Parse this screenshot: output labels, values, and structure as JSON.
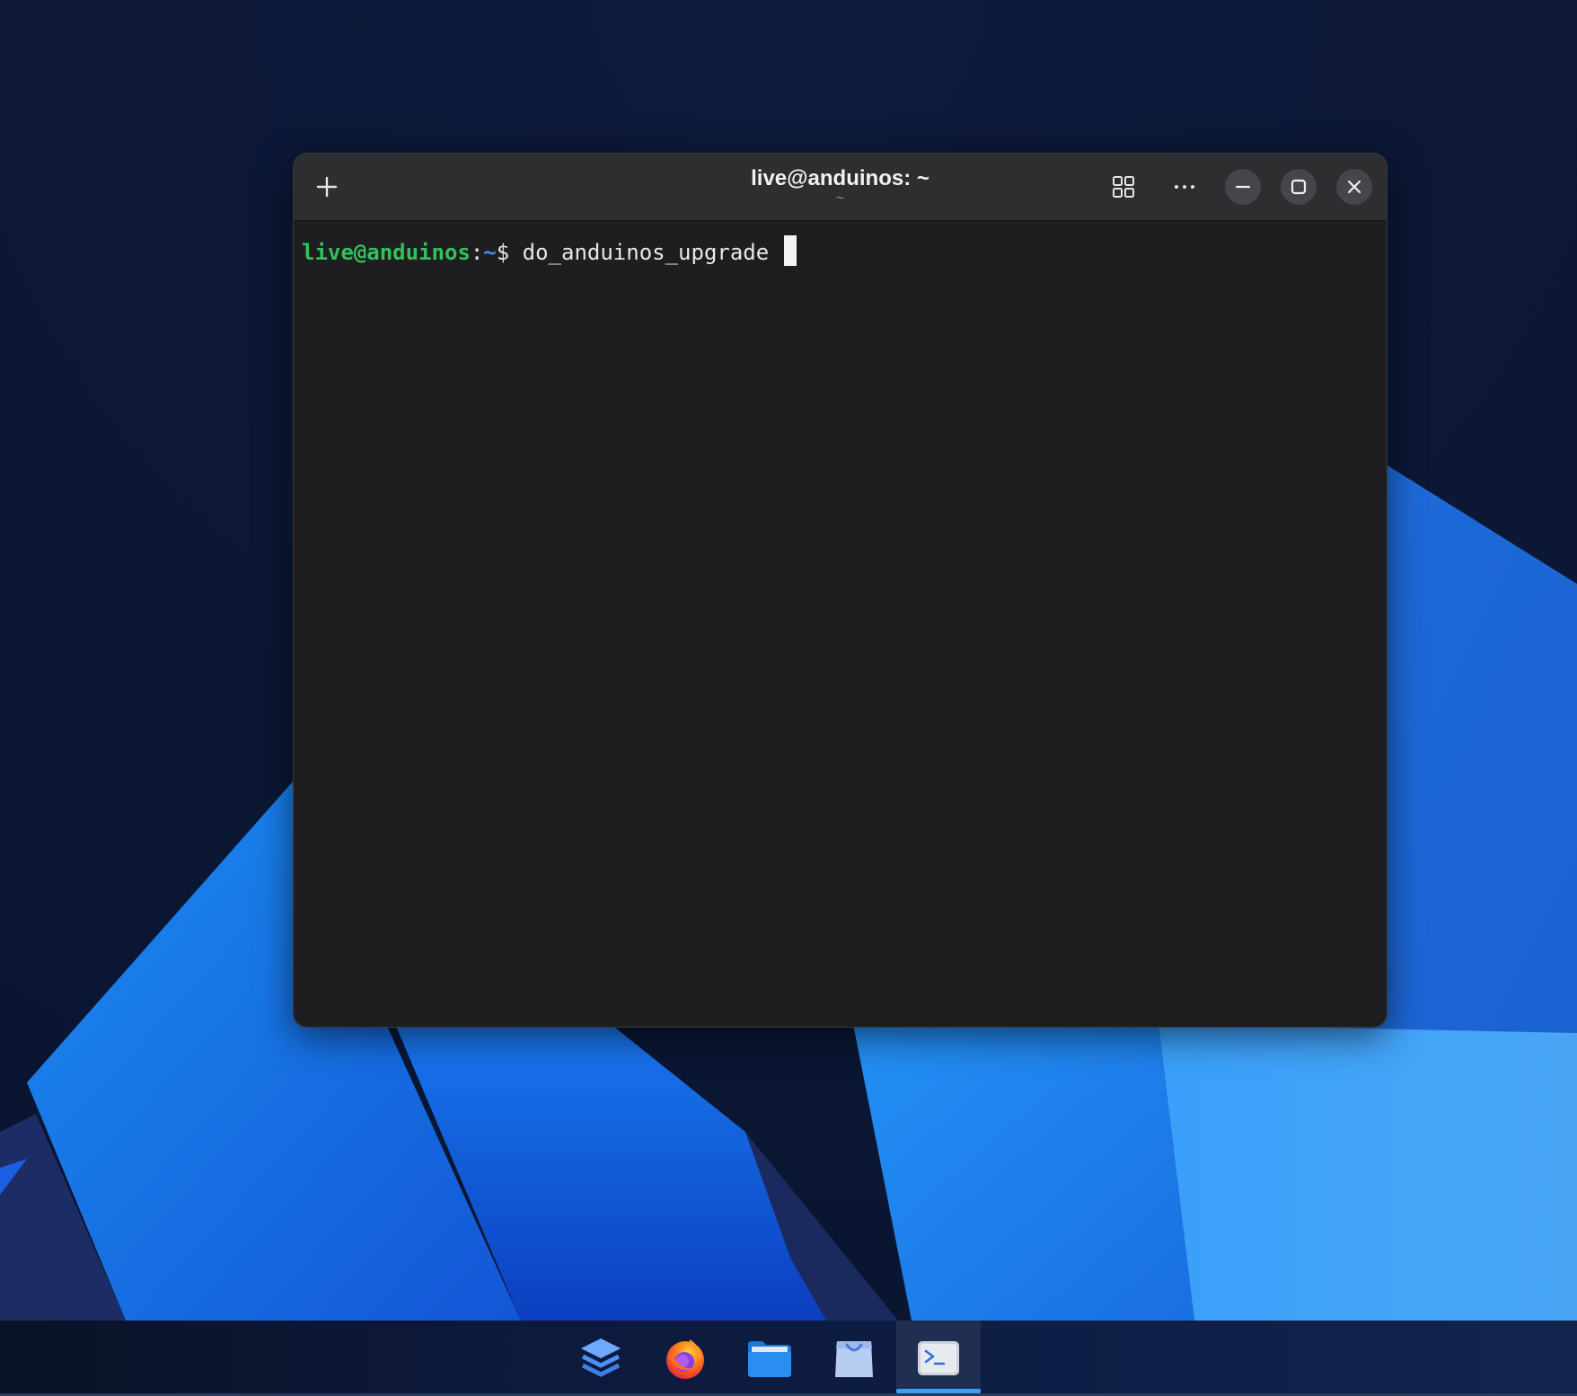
{
  "window": {
    "title": "live@anduinos: ~",
    "subtitle": "~"
  },
  "headerbar": {
    "new_tab_icon": "plus-icon",
    "overview_icon": "grid-icon",
    "menu_icon": "more-horizontal-icon",
    "minimize_icon": "minimize-icon",
    "maximize_icon": "maximize-icon",
    "close_icon": "close-icon"
  },
  "terminal": {
    "prompt_user": "live@anduinos",
    "prompt_sep": ":",
    "prompt_path": "~",
    "prompt_symbol": "$",
    "command": " do_anduinos_upgrade "
  },
  "taskbar": {
    "apps": [
      {
        "name": "layers-app",
        "icon": "layers-icon"
      },
      {
        "name": "firefox",
        "icon": "firefox-icon"
      },
      {
        "name": "files",
        "icon": "folder-icon"
      },
      {
        "name": "software",
        "icon": "shopping-bag-icon"
      },
      {
        "name": "terminal",
        "icon": "terminal-icon",
        "active": true
      }
    ]
  },
  "colors": {
    "prompt_user": "#33c15c",
    "prompt_path": "#3f8cf2",
    "active_indicator": "#3aa0f0"
  }
}
